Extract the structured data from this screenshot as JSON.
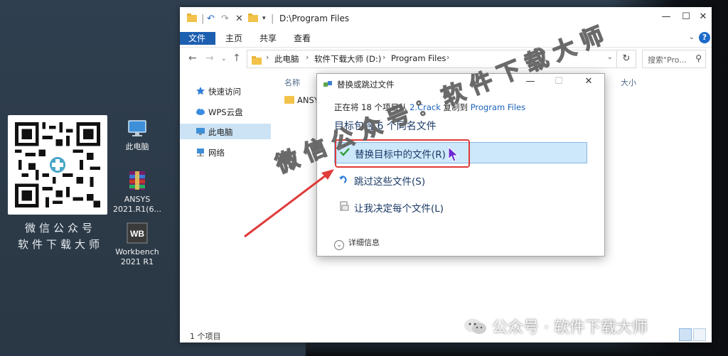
{
  "desktop": {
    "qr_caption_1": "微信公众号",
    "qr_caption_2": "软件下载大师",
    "icons": [
      {
        "label": "此电脑"
      },
      {
        "label": "ANSYS 2021.R1(6..."
      },
      {
        "label": "Workbench 2021 R1",
        "badge": "WB"
      }
    ]
  },
  "explorer": {
    "title": "D:\\Program Files",
    "ribbon_tabs": [
      "文件",
      "主页",
      "共享",
      "查看"
    ],
    "help": "?",
    "address": [
      "此电脑",
      "软件下载大师 (D:)",
      "Program Files"
    ],
    "search_placeholder": "搜索\"Pro...",
    "sidebar": [
      "快速访问",
      "WPS云盘",
      "此电脑",
      "网络"
    ],
    "columns": {
      "name": "名称",
      "size": "大小"
    },
    "files": [
      "ANSY"
    ],
    "status": "1 个项目"
  },
  "dialog": {
    "title": "替换或跳过文件",
    "line1_prefix": "正在将 18 个项目从",
    "line1_source": "2.Crack",
    "line1_middle": "复制到",
    "line1_dest": "Program Files",
    "line2": "目标包含 6 个同名文件",
    "options": [
      "替换目标中的文件(R)",
      "跳过这些文件(S)",
      "让我决定每个文件(L)"
    ],
    "details": "详细信息"
  },
  "watermark": "微信公众号：软件下载大师",
  "footer": "公众号 · 软件下载大师",
  "colors": {
    "accent": "#1c5fb0",
    "highlight": "#e03a3a",
    "selection": "#cde8fb"
  }
}
